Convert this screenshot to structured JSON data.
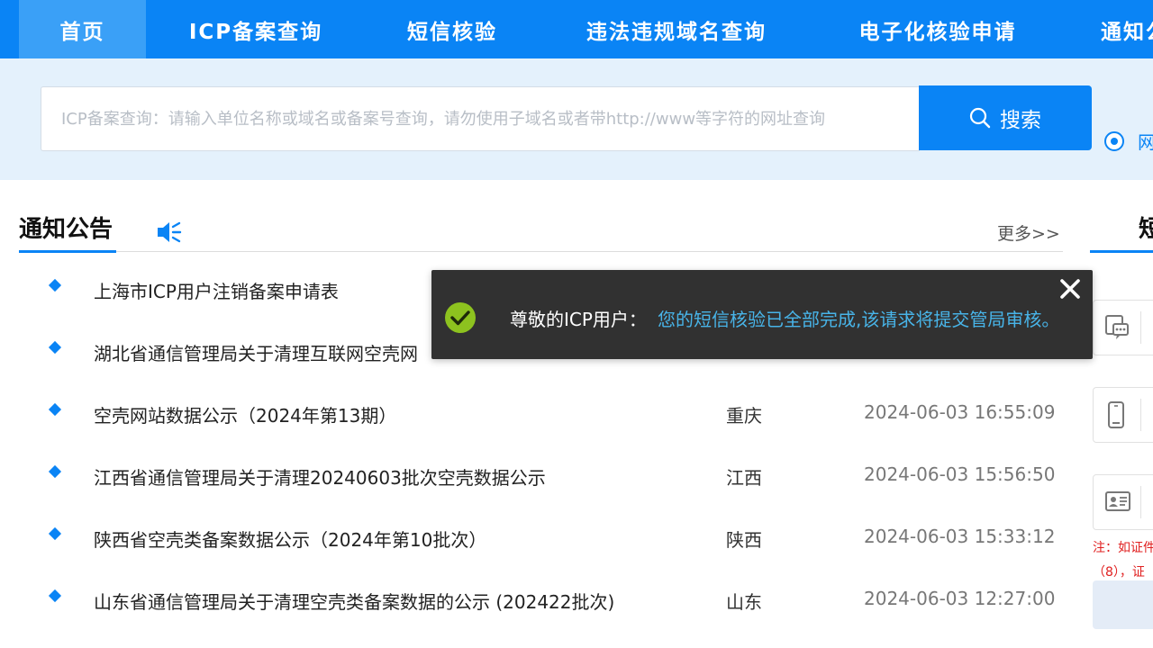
{
  "nav": {
    "items": [
      {
        "label": "首页"
      },
      {
        "label": "ICP备案查询"
      },
      {
        "label": "短信核验"
      },
      {
        "label": "违法违规域名查询"
      },
      {
        "label": "电子化核验申请"
      },
      {
        "label": "通知公"
      }
    ],
    "active_index": 0,
    "bg_color": "#0a84f5",
    "active_color": "#3aa0f7"
  },
  "search": {
    "placeholder": "ICP备案查询：请输入单位名称或域名或备案号查询，请勿使用子域名或者带http://www等字符的网址查询",
    "value": "",
    "button_label": "搜索",
    "button_icon": "search-icon",
    "radio_label": "网"
  },
  "notice": {
    "title": "通知公告",
    "title_icon": "speaker-icon",
    "more_label": "更多>>",
    "rows": [
      {
        "title": "上海市ICP用户注销备案申请表",
        "region": "",
        "time": ""
      },
      {
        "title": "湖北省通信管理局关于清理互联网空壳网",
        "region": "",
        "time": ""
      },
      {
        "title": "空壳网站数据公示（2024年第13期）",
        "region": "重庆",
        "time": "2024-06-03 16:55:09"
      },
      {
        "title": "江西省通信管理局关于清理20240603批次空壳数据公示",
        "region": "江西",
        "time": "2024-06-03 15:56:50"
      },
      {
        "title": "陕西省空壳类备案数据公示（2024年第10批次）",
        "region": "陕西",
        "time": "2024-06-03 15:33:12"
      },
      {
        "title": "山东省通信管理局关于清理空壳类备案数据的公示 (202422批次)",
        "region": "山东",
        "time": "2024-06-03 12:27:00"
      }
    ]
  },
  "right_panel": {
    "title": "短",
    "cards": [
      {
        "icon": "sms-chat-icon"
      },
      {
        "icon": "mobile-phone-icon"
      },
      {
        "icon": "id-card-icon"
      }
    ],
    "note_line1": "注：如证件",
    "note_line2": "（8），证"
  },
  "toast": {
    "icon": "check-circle-icon",
    "label": "尊敬的ICP用户：",
    "message": "您的短信核验已全部完成,该请求将提交管局审核。",
    "close_icon": "close-icon",
    "check_color": "#8dc21f",
    "message_color": "#48b4e8"
  }
}
